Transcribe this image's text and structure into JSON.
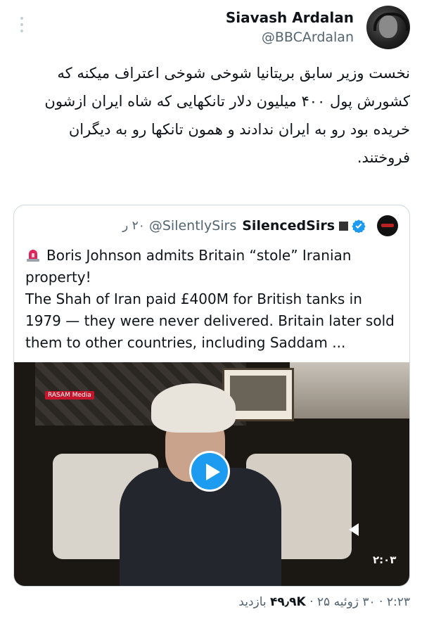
{
  "author": {
    "display_name": "Siavash Ardalan",
    "handle": "@BBCArdalan"
  },
  "tweet": {
    "text": "نخست وزیر سابق بریتانیا شوخی شوخی اعتراف میکنه که کشورش پول ۴۰۰ میلیون دلار تانکهایی که شاه ایران ازشون خریده بود رو به ایران ندادند و همون تانکها رو به دیگران فروختند."
  },
  "quoted": {
    "display_name": "SilencedSirs",
    "handle": "@SilentlySirs",
    "time": "۲۰ ر",
    "line1": "Boris Johnson admits Britain “stole” Iranian property!",
    "line2": "The Shah of Iran paid £400M for British tanks in 1979 — they were never delivered. Britain later sold them to other countries, including Saddam ...",
    "video": {
      "watermark": "RASAM Media",
      "duration": "۲:۰۳"
    }
  },
  "meta": {
    "time": "۲:۲۳",
    "dot1": " · ",
    "date": "۳۰ ژوئیه ۲۵",
    "dot2": " · ",
    "views_count": "۴۹٫۹K",
    "views_label": " بازدید"
  },
  "colors": {
    "accent": "#1d9bf0",
    "secondary_text": "#536471",
    "border": "#cfd9de"
  },
  "icons": [
    "more-icon",
    "verified-badge-icon",
    "siren-icon",
    "play-icon",
    "volume-icon"
  ]
}
